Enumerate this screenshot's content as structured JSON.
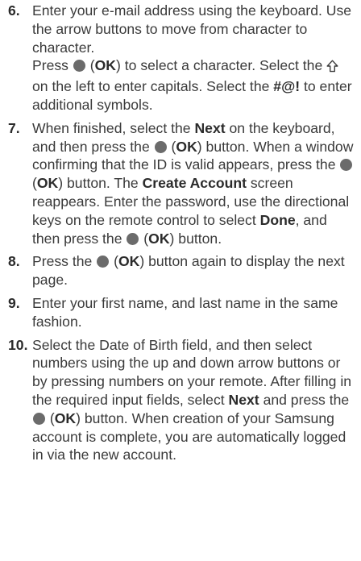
{
  "steps": [
    {
      "num": "6.",
      "p1": "Enter your e-mail address using the keyboard. Use the arrow buttons to move from character to character.",
      "p2_a": "Press",
      "ok_label": "OK",
      "p2_b": "to select a character. Select the",
      "p2_c": "on the left to enter capitals. Select the",
      "symbol_key": "#@!",
      "p2_d": "to enter additional symbols."
    },
    {
      "num": "7.",
      "a": "When finished, select the",
      "next_label": "Next",
      "b": "on the keyboard, and then press the",
      "ok_label": "OK",
      "c": "button. When a window confirming that the ID is valid appears, press the",
      "d": "button. The",
      "create_account_label": "Create Account",
      "e": "screen reappears. Enter the password, use the directional keys on the remote control to select",
      "done_label": "Done",
      "f": ", and then press the",
      "g": "button."
    },
    {
      "num": "8.",
      "a": "Press the",
      "ok_label": "OK",
      "b": "button again to display the next page."
    },
    {
      "num": "9.",
      "text": "Enter your first name, and last name in the same fashion."
    },
    {
      "num": "10.",
      "a": "Select the Date of Birth field, and then select numbers using the up and down arrow buttons or by pressing numbers on your remote. After filling in the required input fields, select",
      "next_label": "Next",
      "b": "and press the",
      "ok_label": "OK",
      "c": "button. When creation of your Samsung account is complete, you are automatically logged in via the new account."
    }
  ],
  "colors": {
    "ok_button_icon": "#6b6b6b",
    "text": "#3a3a3a"
  },
  "icons": {
    "ok_button": "filled-circle-icon",
    "shift_key": "up-arrow-outline-icon"
  }
}
